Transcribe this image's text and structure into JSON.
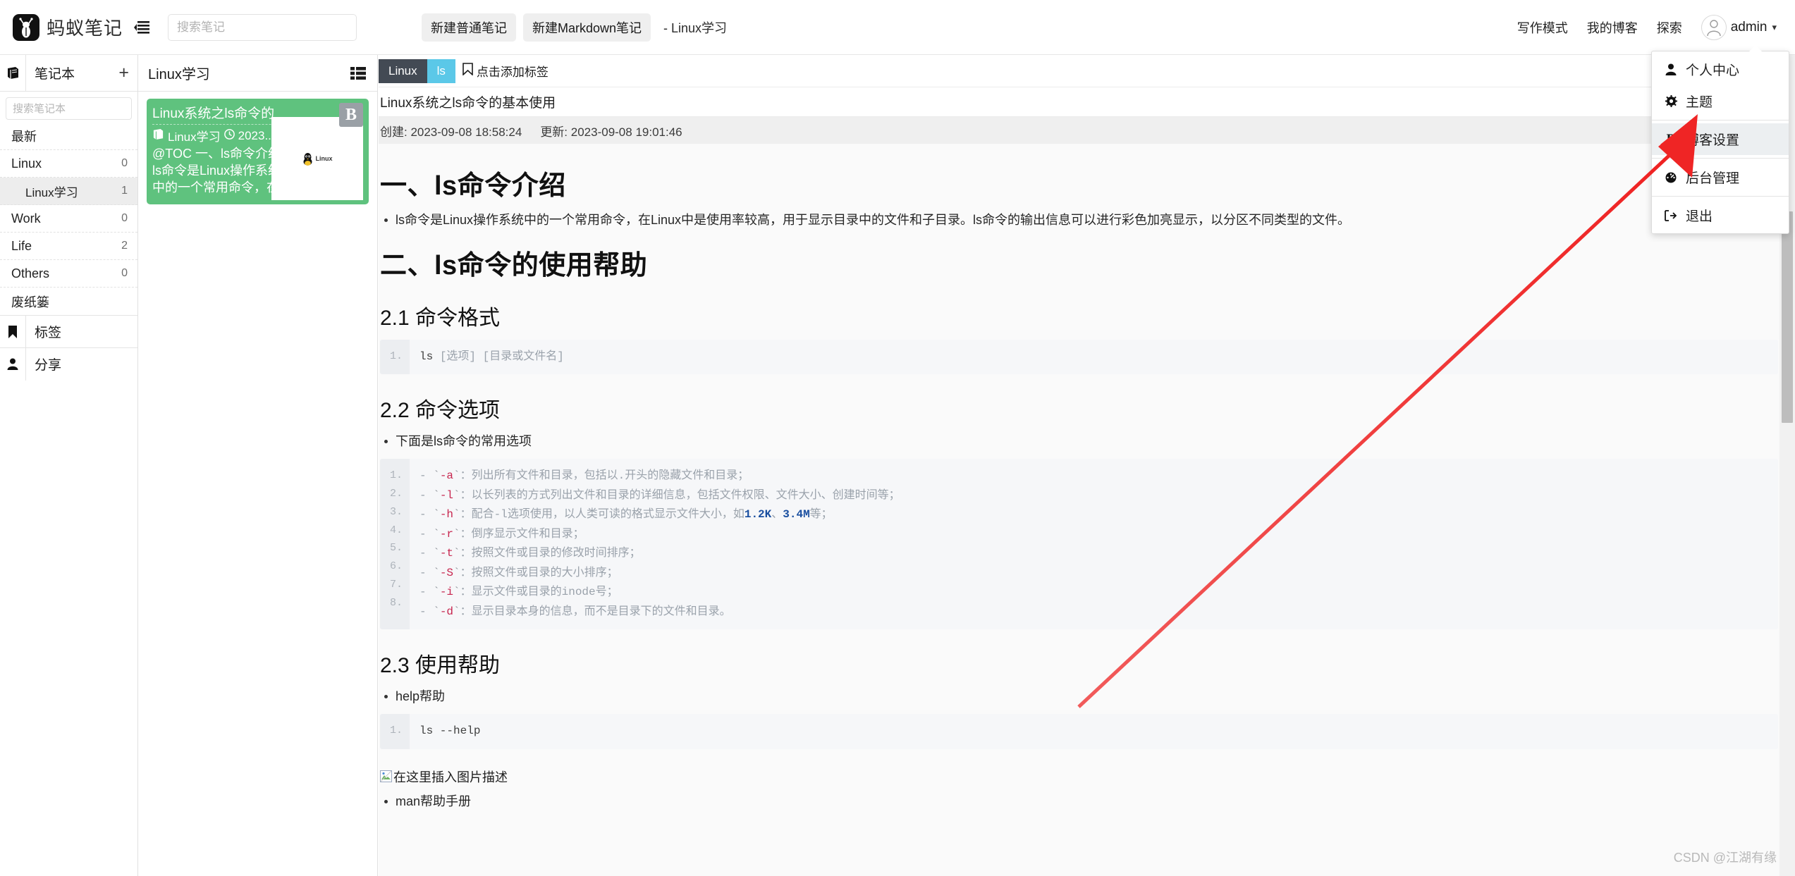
{
  "header": {
    "brand_name": "蚂蚁笔记",
    "logo_icon": "ant-logo-icon",
    "menu_icon": "hamburger-icon",
    "search_placeholder": "搜索笔记",
    "search_value": "",
    "new_plain_note": "新建普通笔记",
    "new_markdown_note": "新建Markdown笔记",
    "breadcrumb": "- Linux学习",
    "links": [
      "写作模式",
      "我的博客",
      "探索"
    ],
    "user_name": "admin",
    "caret_icon": "chevron-down-icon"
  },
  "user_menu": {
    "items": [
      {
        "label": "个人中心",
        "icon": "user-icon",
        "active": false
      },
      {
        "label": "主题",
        "icon": "gear-icon",
        "active": false
      },
      {
        "label": "博客设置",
        "icon": "blog-b-icon",
        "active": true
      },
      {
        "label": "后台管理",
        "icon": "dashboard-icon",
        "active": false
      },
      {
        "label": "退出",
        "icon": "logout-icon",
        "active": false
      }
    ]
  },
  "notebook_panel": {
    "header_title": "笔记本",
    "header_icon": "notebook-icon",
    "add_icon": "plus-icon",
    "search_placeholder": "搜索笔记本",
    "search_value": "",
    "items": [
      {
        "label": "最新",
        "count": "",
        "sub": false
      },
      {
        "label": "Linux",
        "count": "0",
        "sub": false
      },
      {
        "label": "Linux学习",
        "count": "1",
        "sub": true
      },
      {
        "label": "Work",
        "count": "0",
        "sub": false
      },
      {
        "label": "Life",
        "count": "2",
        "sub": false
      },
      {
        "label": "Others",
        "count": "0",
        "sub": false
      },
      {
        "label": "废纸篓",
        "count": "",
        "sub": false
      }
    ],
    "footer": [
      {
        "label": "标签",
        "icon": "tag-bookmark-icon"
      },
      {
        "label": "分享",
        "icon": "share-user-icon"
      }
    ]
  },
  "list_panel": {
    "title": "Linux学习",
    "view_icon": "list-view-icon",
    "note": {
      "title": "Linux系统之ls命令的",
      "notebook": "Linux学习",
      "notebook_icon": "notebook-icon",
      "clock_icon": "clock-icon",
      "date": "2023...",
      "preview_line1": "@TOC 一、ls命令介绍",
      "preview_line2": "ls命令是Linux操作系统",
      "preview_line3": "中的一个常用命令，在",
      "badge": "B",
      "thumb_label": "Linux",
      "card_color": "#5fc27e"
    }
  },
  "note": {
    "tags": [
      {
        "label": "Linux",
        "color": "#434a54"
      },
      {
        "label": "ls",
        "color": "#5bc8e8"
      }
    ],
    "add_tag_label": "点击添加标签",
    "add_tag_icon": "tag-icon",
    "edit_icon": "edit-pencil-icon",
    "title": "Linux系统之ls命令的基本使用",
    "created_label": "创建: 2023-09-08 18:58:24",
    "updated_label": "更新: 2023-09-08 19:01:46"
  },
  "document": {
    "h1_1": "一、ls命令介绍",
    "p1": "ls命令是Linux操作系统中的一个常用命令，在Linux中是使用率较高，用于显示目录中的文件和子目录。ls命令的输出信息可以进行彩色加亮显示，以分区不同类型的文件。",
    "h1_2": "二、ls命令的使用帮助",
    "h2_1": "2.1 命令格式",
    "code1": {
      "lines": [
        "1."
      ],
      "cmd": "ls",
      "arg1": "[选项]",
      "arg2": "[目录或文件名]"
    },
    "h2_2": "2.2 命令选项",
    "p2": "下面是ls命令的常用选项",
    "code2": {
      "lines": [
        "1.",
        "2.",
        "3.",
        "4.",
        "5.",
        "6.",
        "7.",
        "8."
      ],
      "rows": [
        {
          "flag": "-a",
          "desc": "：列出所有文件和目录，包括以.开头的隐藏文件和目录；"
        },
        {
          "flag": "-l",
          "desc": "：以长列表的方式列出文件和目录的详细信息，包括文件权限、文件大小、创建时间等；"
        },
        {
          "flag": "-h",
          "desc": "：配合-l选项使用，以人类可读的格式显示文件大小，如",
          "hl1": "1.2K",
          "mid": "、",
          "hl2": "3.4M",
          "tail": "等；"
        },
        {
          "flag": "-r",
          "desc": "：倒序显示文件和目录；"
        },
        {
          "flag": "-t",
          "desc": "：按照文件或目录的修改时间排序；"
        },
        {
          "flag": "-S",
          "desc": "：按照文件或目录的大小排序；"
        },
        {
          "flag": "-i",
          "desc": "：显示文件或目录的inode号；"
        },
        {
          "flag": "-d",
          "desc": "：显示目录本身的信息，而不是目录下的文件和目录。"
        }
      ]
    },
    "h2_3": "2.3 使用帮助",
    "p3": "help帮助",
    "code3": {
      "lines": [
        "1."
      ],
      "cmd": "ls --help"
    },
    "broken_image_alt": "在这里插入图片描述",
    "p4": "man帮助手册"
  },
  "scrollbar": {
    "thumb_icon": "scrollbar-thumb"
  },
  "annotation": {
    "arrow_color": "#ef2f2f"
  },
  "watermark": "CSDN @江湖有缘"
}
